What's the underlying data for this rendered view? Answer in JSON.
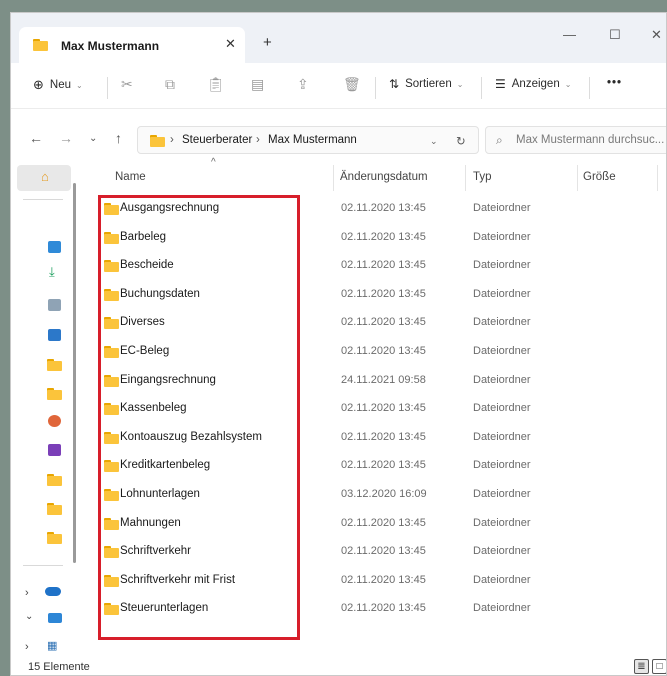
{
  "window": {
    "tab_title": "Max Mustermann",
    "tab_close": "✕",
    "new_tab": "+",
    "controls": {
      "minimize": "—",
      "maximize": "☐",
      "close": "✕"
    }
  },
  "toolbar": {
    "new_label": "Neu",
    "sort_label": "Sortieren",
    "view_label": "Anzeigen",
    "more_label": "•••"
  },
  "addressbar": {
    "crumbs": [
      "Steuerberater",
      "Max Mustermann"
    ],
    "separator": "›",
    "search_placeholder": "Max Mustermann durchsuc..."
  },
  "columns": {
    "name": "Name",
    "date": "Änderungsdatum",
    "type": "Typ",
    "size": "Größe"
  },
  "files": [
    {
      "name": "Ausgangsrechnung",
      "date": "02.11.2020 13:45",
      "type": "Dateiordner"
    },
    {
      "name": "Barbeleg",
      "date": "02.11.2020 13:45",
      "type": "Dateiordner"
    },
    {
      "name": "Bescheide",
      "date": "02.11.2020 13:45",
      "type": "Dateiordner"
    },
    {
      "name": "Buchungsdaten",
      "date": "02.11.2020 13:45",
      "type": "Dateiordner"
    },
    {
      "name": "Diverses",
      "date": "02.11.2020 13:45",
      "type": "Dateiordner"
    },
    {
      "name": "EC-Beleg",
      "date": "02.11.2020 13:45",
      "type": "Dateiordner"
    },
    {
      "name": "Eingangsrechnung",
      "date": "24.11.2021 09:58",
      "type": "Dateiordner"
    },
    {
      "name": "Kassenbeleg",
      "date": "02.11.2020 13:45",
      "type": "Dateiordner"
    },
    {
      "name": "Kontoauszug Bezahlsystem",
      "date": "02.11.2020 13:45",
      "type": "Dateiordner"
    },
    {
      "name": "Kreditkartenbeleg",
      "date": "02.11.2020 13:45",
      "type": "Dateiordner"
    },
    {
      "name": "Lohnunterlagen",
      "date": "03.12.2020 16:09",
      "type": "Dateiordner"
    },
    {
      "name": "Mahnungen",
      "date": "02.11.2020 13:45",
      "type": "Dateiordner"
    },
    {
      "name": "Schriftverkehr",
      "date": "02.11.2020 13:45",
      "type": "Dateiordner"
    },
    {
      "name": "Schriftverkehr mit Frist",
      "date": "02.11.2020 13:45",
      "type": "Dateiordner"
    },
    {
      "name": "Steuerunterlagen",
      "date": "02.11.2020 13:45",
      "type": "Dateiordner"
    }
  ],
  "status": {
    "count": "15 Elemente"
  },
  "colors": {
    "highlight": "#d71e2a",
    "folder": "#fbc43b"
  }
}
